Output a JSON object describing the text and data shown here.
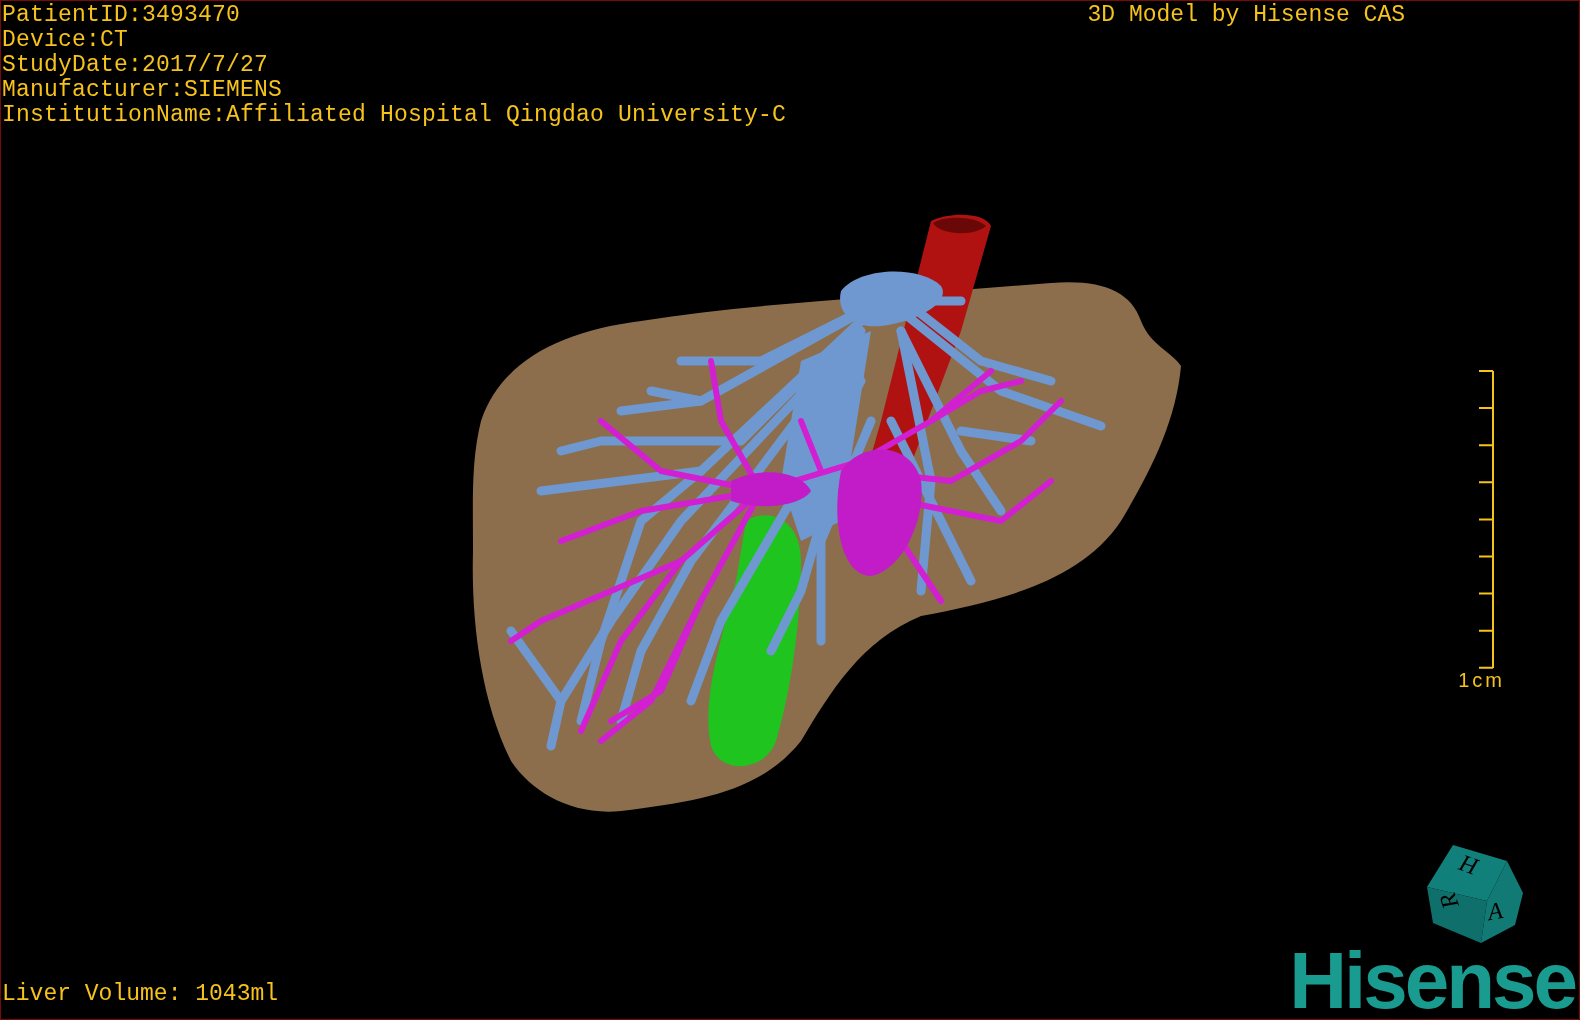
{
  "info_lines": [
    "PatientID:3493470",
    "Device:CT",
    "StudyDate:2017/7/27",
    "Manufacturer:SIEMENS",
    "InstitutionName:Affiliated Hospital Qingdao University-C"
  ],
  "title": "3D Model by Hisense CAS",
  "scale_bar": {
    "label": "1cm"
  },
  "orientation_cube": {
    "faces": [
      "H",
      "R",
      "A"
    ]
  },
  "liver_volume": "Liver Volume: 1043ml",
  "logo": "Hisense"
}
